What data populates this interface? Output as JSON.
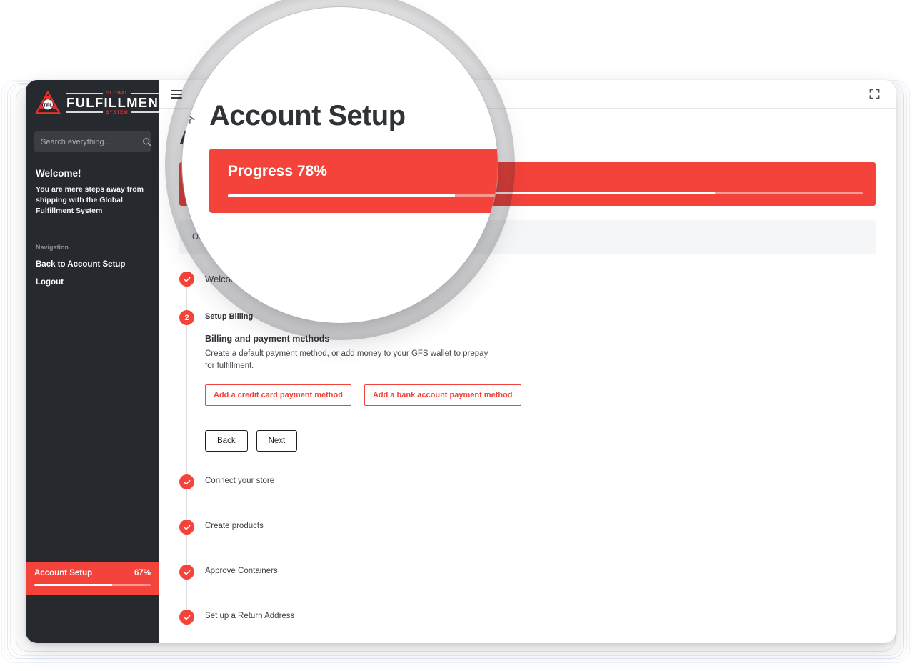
{
  "brand": {
    "logo_top_word": "GLOBAL",
    "logo_main_word": "FULFILLMENT",
    "logo_bottom_word": "SYSTEM",
    "logo_monogram": "TFL",
    "accent_red": "#F4433B",
    "sidebar_bg": "#26292E"
  },
  "sidebar": {
    "search": {
      "value": "",
      "placeholder": "Search everything..."
    },
    "welcome_title": "Welcome!",
    "welcome_text": "You are mere steps away from shipping with the Global Fulfillment System",
    "nav_label": "Navigation",
    "nav_items": [
      {
        "label": "Back to Account Setup"
      },
      {
        "label": "Logout"
      }
    ],
    "account_progress": {
      "label": "Account Setup",
      "percent_text": "67%",
      "percent_value": 67
    }
  },
  "topbar": {
    "menu_icon": "hamburger-icon",
    "fullscreen_icon": "fullscreen-icon"
  },
  "main": {
    "page_title": "Account Setup",
    "progress_banner": {
      "label": "Progress 78%",
      "percent_value": 78
    },
    "info_banner": "Once you complete these steps you will have access to the full GFS platform.",
    "steps": [
      {
        "marker": "check",
        "title": "Welcome to the Global Fulfillment System"
      },
      {
        "marker": "2",
        "title": "Setup Billing",
        "panel": {
          "heading": "Billing and payment methods",
          "text": "Create a default payment method, or add money to your GFS wallet to prepay for fulfillment.",
          "actions": [
            {
              "label": "Add a credit card payment method"
            },
            {
              "label": "Add a bank account payment method"
            }
          ],
          "nav_buttons": [
            {
              "label": "Back"
            },
            {
              "label": "Next"
            }
          ]
        }
      },
      {
        "marker": "check",
        "title": "Connect your store"
      },
      {
        "marker": "check",
        "title": "Create products"
      },
      {
        "marker": "check",
        "title": "Approve Containers"
      },
      {
        "marker": "check",
        "title": "Set up a Return Address"
      }
    ]
  },
  "magnifier": {
    "title": "Account Setup",
    "banner_label": "Progress 78%",
    "banner_percent": 78,
    "ghost_letter": "A"
  }
}
